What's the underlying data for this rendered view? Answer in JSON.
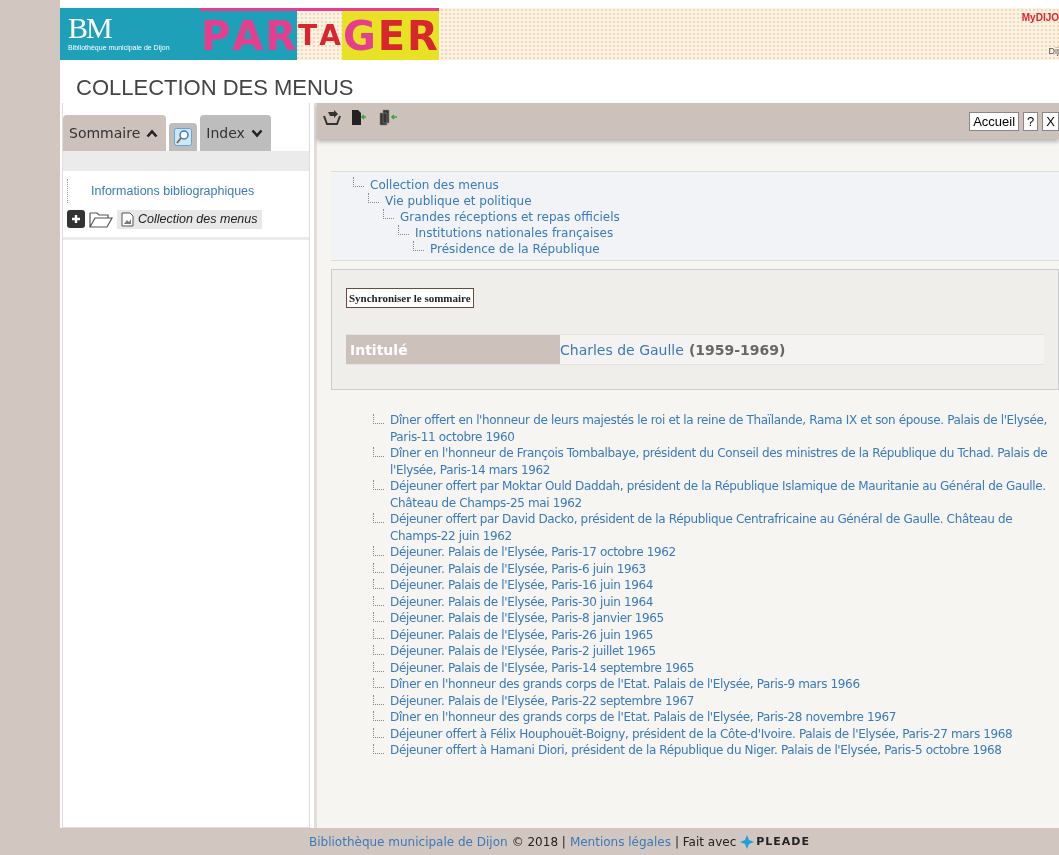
{
  "banner": {
    "logo_mark": "BM",
    "logo_caption": "Bibliothèque municipale de Dijon",
    "logo_word": [
      "P",
      "A",
      "R",
      "T",
      "A",
      "G",
      "E",
      "R"
    ],
    "partner_logo": "MyDIJO",
    "partner_caption": "Dij"
  },
  "page_title": "COLLECTION DES MENUS",
  "sidebar": {
    "tabs": [
      {
        "kind": "text",
        "label": "Sommaire",
        "expanded": true,
        "selected": true
      },
      {
        "kind": "search",
        "selected": false
      },
      {
        "kind": "text",
        "label": "Index",
        "expanded": false,
        "selected": false
      }
    ],
    "tree": [
      {
        "label": "Informations bibliographiques",
        "kind": "link"
      },
      {
        "label": "Collection des menus",
        "kind": "folder",
        "expanded": false,
        "selected": true
      }
    ]
  },
  "toolbar": {
    "buttons": [
      "Accueil",
      "?",
      "X"
    ]
  },
  "breadcrumb": [
    {
      "label": "Collection des menus",
      "children": [
        {
          "label": "Vie publique et politique",
          "children": [
            {
              "label": "Grandes réceptions et repas officiels",
              "children": [
                {
                  "label": "Institutions nationales françaises",
                  "children": [
                    {
                      "label": "Présidence de la République"
                    }
                  ]
                }
              ]
            }
          ]
        }
      ]
    }
  ],
  "record": {
    "sync_button": "Synchroniser le sommaire",
    "field_label": "Intitulé",
    "title_link": "Charles de Gaulle",
    "title_dates": "(1959-1969)"
  },
  "items": [
    "Dîner offert en l'honneur de leurs majestés le roi et la reine de Thaïlande, Rama IX et son épouse. Palais de l'Elysée, Paris-11 octobre 1960",
    "Dîner en l'honneur de François Tombalbaye, président du Conseil des ministres de la République du Tchad. Palais de l'Elysée, Paris-14 mars 1962",
    "Déjeuner offert par Moktar Ould Daddah, président de la République Islamique de Mauritanie au Général de Gaulle. Château de Champs-25 mai 1962",
    "Déjeuner offert par David Dacko, président de la République Centrafricaine au Général de Gaulle. Château de Champs-22 juin 1962",
    "Déjeuner. Palais de l'Elysée, Paris-17 octobre 1962",
    "Déjeuner. Palais de l'Elysée, Paris-6 juin 1963",
    "Déjeuner. Palais de l'Elysée, Paris-16 juin 1964",
    "Déjeuner. Palais de l'Elysée, Paris-30 juin 1964",
    "Déjeuner. Palais de l'Elysée, Paris-8 janvier 1965",
    "Déjeuner. Palais de l'Elysée, Paris-26 juin 1965",
    "Déjeuner. Palais de l'Elysée, Paris-2 juillet 1965",
    "Déjeuner. Palais de l'Elysée, Paris-14 septembre 1965",
    "Dîner en l'honneur des grands corps de l'Etat. Palais de l'Elysée, Paris-9 mars 1966",
    "Déjeuner. Palais de l'Elysée, Paris-22 septembre 1967",
    "Dîner en l'honneur des grands corps de l'Etat. Palais de l'Elysée, Paris-28 novembre 1967",
    "Déjeuner offert à Félix Houphouët-Boigny, président de la Côte-d'Ivoire. Palais de l'Elysée, Paris-27 mars 1968",
    "Déjeuner offert à Hamani Diori, président de la République du Niger. Palais de l'Elysée, Paris-5 octobre 1968"
  ],
  "footer": {
    "library_link": "Bibliothèque municipale de Dijon",
    "copyright": "© 2018 |",
    "legal_link": "Mentions légales",
    "made_with": "| Fait avec",
    "brand": "PLEADE"
  }
}
